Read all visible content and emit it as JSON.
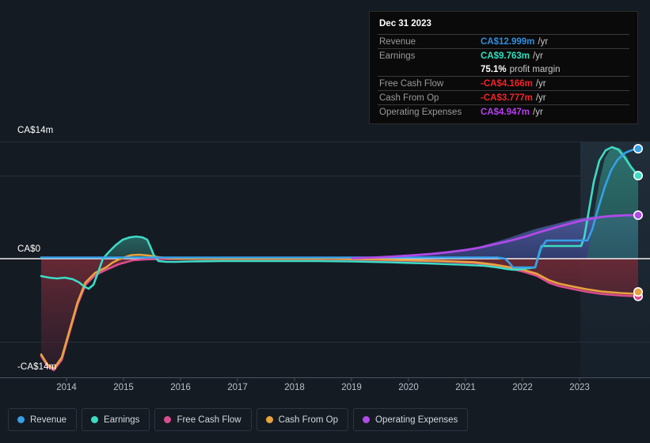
{
  "colors": {
    "background": "#151b23",
    "revenue": "#35a0e8",
    "earnings": "#3ddbc4",
    "free_cash_flow": "#db4d8f",
    "cash_from_op": "#e8a33d",
    "operating_expenses": "#b04ae8",
    "negative_area": "#5c2632",
    "positive_area": "#4a5a9e",
    "earnings_area": "#2a6a66",
    "gridline": "#272e3a",
    "zero_line": "#ffffff",
    "axis_line": "#3a4350",
    "forecast_band": "#1a2430"
  },
  "axes": {
    "y_labels": {
      "top": "CA$14m",
      "zero": "CA$0",
      "bottom": "-CA$14m"
    },
    "y_range": [
      -14,
      14
    ],
    "x_labels": [
      "2014",
      "2015",
      "2016",
      "2017",
      "2018",
      "2019",
      "2020",
      "2021",
      "2022",
      "2023"
    ]
  },
  "tooltip": {
    "title": "Dec 31 2023",
    "rows": [
      {
        "key": "Revenue",
        "value": "CA$12.999m",
        "unit": "/yr",
        "color_class": "v-revenue"
      },
      {
        "key": "Earnings",
        "value": "CA$9.763m",
        "unit": "/yr",
        "color_class": "v-earnings"
      },
      {
        "key": "",
        "value": "75.1%",
        "unit": "profit margin",
        "color_class": "v-white",
        "no_rule": true
      },
      {
        "key": "Free Cash Flow",
        "value": "-CA$4.166m",
        "unit": "/yr",
        "color_class": "v-neg"
      },
      {
        "key": "Cash From Op",
        "value": "-CA$3.777m",
        "unit": "/yr",
        "color_class": "v-neg"
      },
      {
        "key": "Operating Expenses",
        "value": "CA$4.947m",
        "unit": "/yr",
        "color_class": "v-opex"
      }
    ]
  },
  "legend": {
    "items": [
      {
        "label": "Revenue",
        "color": "#35a0e8"
      },
      {
        "label": "Earnings",
        "color": "#3ddbc4"
      },
      {
        "label": "Free Cash Flow",
        "color": "#db4d8f"
      },
      {
        "label": "Cash From Op",
        "color": "#e8a33d"
      },
      {
        "label": "Operating Expenses",
        "color": "#b04ae8"
      }
    ]
  },
  "chart_data": {
    "type": "line",
    "title": "",
    "xlabel": "",
    "ylabel": "CA$",
    "ylim": [
      -14,
      14
    ],
    "xlim": [
      2013.2,
      2024.0
    ],
    "grid": true,
    "legend_position": "bottom",
    "currency": "CA$",
    "units": "millions per year",
    "gridline_values": [
      14,
      10.5,
      0,
      -10.5,
      -14
    ],
    "forecast_start": 2023.0,
    "x": [
      2013.3,
      2013.6,
      2013.9,
      2014.2,
      2014.5,
      2014.8,
      2015.1,
      2015.4,
      2015.7,
      2016.0,
      2016.5,
      2017.0,
      2017.5,
      2018.0,
      2018.5,
      2019.0,
      2019.5,
      2020.0,
      2020.5,
      2021.0,
      2021.3,
      2021.6,
      2021.9,
      2022.1,
      2022.3,
      2022.5,
      2022.8,
      2023.0,
      2023.3,
      2023.6,
      2023.9
    ],
    "series": [
      {
        "name": "Revenue",
        "color": "#35a0e8",
        "values": [
          0.1,
          0.1,
          0.1,
          0.1,
          0.1,
          0.1,
          0.1,
          0.1,
          0.1,
          0.1,
          0.1,
          0.1,
          0.1,
          0.1,
          0.1,
          0.1,
          0.1,
          0.1,
          0.1,
          0.1,
          0.1,
          -0.4,
          1.0,
          1.0,
          3.0,
          3.0,
          3.0,
          3.2,
          7.0,
          11.5,
          12.999
        ],
        "endpoint_value": 12.999
      },
      {
        "name": "Earnings",
        "color": "#3ddbc4",
        "values": [
          -2.4,
          -2.4,
          -2.3,
          -2.6,
          -3.4,
          -1.0,
          0.9,
          1.6,
          1.7,
          0.2,
          -0.1,
          -0.1,
          -0.1,
          -0.1,
          -0.1,
          -0.1,
          -0.2,
          -0.3,
          -0.4,
          -0.5,
          -0.8,
          -0.9,
          0.9,
          0.9,
          0.9,
          1.0,
          1.2,
          1.3,
          10.0,
          13.3,
          9.763
        ],
        "endpoint_value": 9.763
      },
      {
        "name": "Free Cash Flow",
        "color": "#db4d8f",
        "values": [
          -12.4,
          -13.6,
          -11.0,
          -7.6,
          -7.0,
          -4.2,
          -1.2,
          -0.6,
          -0.2,
          0.0,
          -0.1,
          -0.1,
          -0.1,
          -0.1,
          -0.1,
          -0.2,
          -0.3,
          -0.3,
          -0.4,
          -0.5,
          -0.7,
          -0.9,
          -1.1,
          -1.4,
          -2.3,
          -2.6,
          -3.0,
          -3.3,
          -3.8,
          -4.1,
          -4.166
        ],
        "endpoint_value": -4.166
      },
      {
        "name": "Cash From Op",
        "color": "#e8a33d",
        "values": [
          -12.0,
          -13.4,
          -10.6,
          -7.2,
          -6.6,
          -3.9,
          -1.0,
          -0.5,
          -0.1,
          0.1,
          0.0,
          0.0,
          0.0,
          0.0,
          0.0,
          -0.1,
          -0.2,
          -0.2,
          -0.3,
          -0.4,
          -0.6,
          -0.8,
          -1.0,
          -1.2,
          -2.0,
          -2.3,
          -2.7,
          -3.0,
          -3.4,
          -3.7,
          -3.777
        ],
        "endpoint_value": -3.777
      },
      {
        "name": "Operating Expenses",
        "color": "#b04ae8",
        "values": [
          null,
          null,
          null,
          null,
          null,
          null,
          null,
          null,
          null,
          null,
          null,
          null,
          null,
          null,
          null,
          0.1,
          0.15,
          0.2,
          0.3,
          0.5,
          0.7,
          0.9,
          1.4,
          1.8,
          2.2,
          2.6,
          3.2,
          3.6,
          4.1,
          4.6,
          4.947
        ],
        "endpoint_value": 4.947
      }
    ]
  }
}
